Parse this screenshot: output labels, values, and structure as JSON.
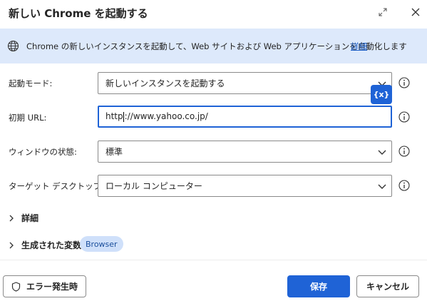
{
  "dialog": {
    "title": "新しい Chrome を起動する",
    "expand_icon": "expand-icon",
    "close_icon": "close-icon"
  },
  "banner": {
    "icon": "globe-icon",
    "text": "Chrome の新しいインスタンスを起動して、Web サイトおよび Web アプリケーションを自動化します",
    "link": "詳細",
    "background": "#dde9fb"
  },
  "fields": {
    "launch_mode": {
      "label": "起動モード:",
      "value": "新しいインスタンスを起動する"
    },
    "initial_url": {
      "label": "初期 URL:",
      "value_before_caret": "http",
      "value_after_caret": "://www.yahoo.co.jp/"
    },
    "window_state": {
      "label": "ウィンドウの状態:",
      "value": "標準"
    },
    "target_desktop": {
      "label": "ターゲット デスクトップ:",
      "value": "ローカル コンピューター"
    }
  },
  "variable_button": "{x}",
  "sections": {
    "advanced": "詳細",
    "generated_variables": "生成された変数",
    "variable_badge": "Browser"
  },
  "footer": {
    "on_error": "エラー発生時",
    "save": "保存",
    "cancel": "キャンセル"
  },
  "colors": {
    "accent": "#1f63d6",
    "link": "#1b5fc9",
    "badge_bg": "#cfe0fa"
  }
}
